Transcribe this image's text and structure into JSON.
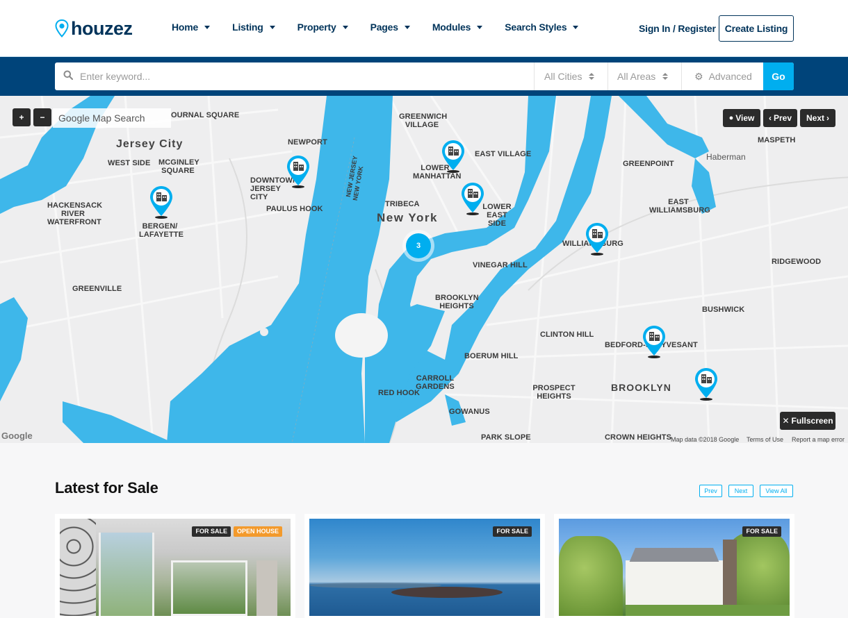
{
  "brand": {
    "name": "houzez",
    "colors": {
      "primary": "#00335a",
      "search_bg": "#00447a",
      "accent": "#00aeef",
      "water": "#3eb7ea",
      "open_house": "#f39a2c"
    }
  },
  "nav": {
    "items": [
      {
        "label": "Home",
        "has_dropdown": true
      },
      {
        "label": "Listing",
        "has_dropdown": true
      },
      {
        "label": "Property",
        "has_dropdown": true
      },
      {
        "label": "Pages",
        "has_dropdown": true
      },
      {
        "label": "Modules",
        "has_dropdown": true
      },
      {
        "label": "Search Styles",
        "has_dropdown": true
      }
    ],
    "signin": "Sign In / Register",
    "create_listing": "Create Listing"
  },
  "search": {
    "keyword_placeholder": "Enter keyword...",
    "keyword_value": "",
    "cities": "All Cities",
    "areas": "All Areas",
    "advanced": "Advanced",
    "go": "Go"
  },
  "map": {
    "zoom_in": "+",
    "zoom_out": "−",
    "search_label": "Google Map Search",
    "view": "View",
    "prev": "Prev",
    "next": "Next",
    "fullscreen": "Fullscreen",
    "cluster_count": "3",
    "attribution": {
      "data": "Map data ©2018 Google",
      "terms": "Terms of Use",
      "report": "Report a map error",
      "logo": "Google"
    },
    "labels": [
      "Jersey City",
      "WEST SIDE",
      "MCGINLEY SQUARE",
      "OURNAL SQUARE",
      "NEWPORT",
      "DOWNTOWN JERSEY CITY",
      "PAULUS HOOK",
      "HACKENSACK RIVER WATERFRONT",
      "BERGEN/ LAFAYETTE",
      "GREENVILLE",
      "GREENWICH VILLAGE",
      "EAST VILLAGE",
      "LOWER MANHATTAN",
      "LOWER EAST SIDE",
      "TRIBECA",
      "New York",
      "NEW JERSEY",
      "NEW YORK",
      "VINEGAR HILL",
      "BROOKLYN HEIGHTS",
      "GREENPOINT",
      "EAST WILLIAMSBURG",
      "WILLIAMSBURG",
      "MASPETH",
      "Haberman",
      "RIDGEWOOD",
      "BUSHWICK",
      "CLINTON HILL",
      "BEDFORD-STUYVESANT",
      "BOERUM HILL",
      "CARROLL GARDENS",
      "RED HOOK",
      "GOWANUS",
      "PROSPECT HEIGHTS",
      "BROOKLYN",
      "PARK SLOPE",
      "CROWN HEIGHTS"
    ]
  },
  "latest": {
    "title": "Latest for Sale",
    "prev": "Prev",
    "next": "Next",
    "view_all": "View All",
    "cards": [
      {
        "badges": [
          "FOR SALE",
          "OPEN HOUSE"
        ],
        "image": "interior-living-room"
      },
      {
        "badges": [
          "FOR SALE"
        ],
        "image": "sea-island-view"
      },
      {
        "badges": [
          "FOR SALE"
        ],
        "image": "white-mansion-garden"
      }
    ]
  }
}
